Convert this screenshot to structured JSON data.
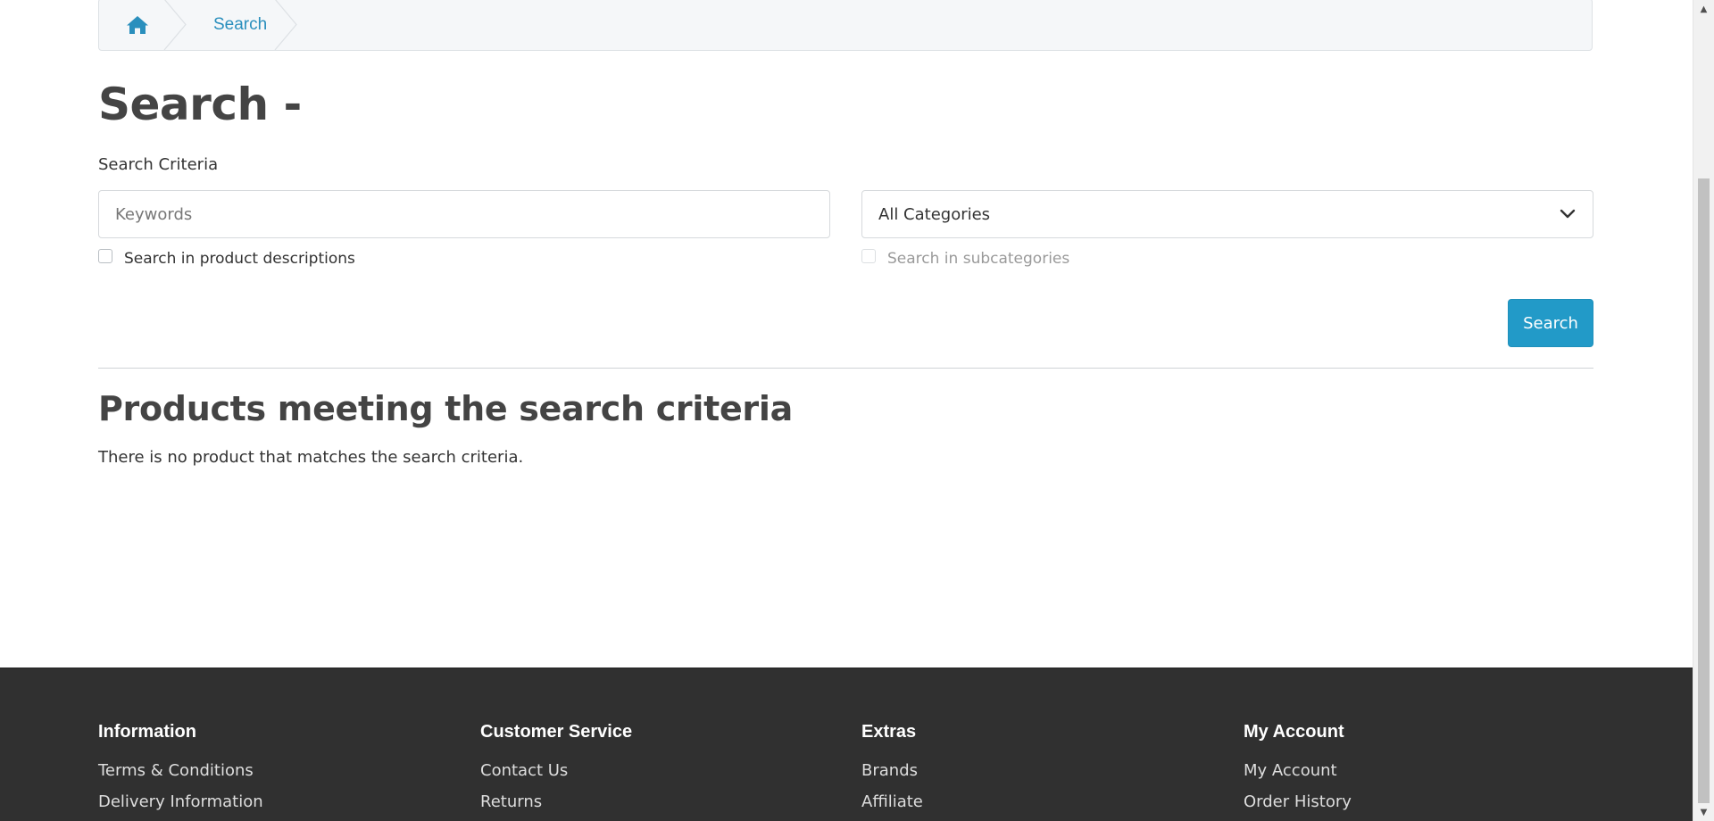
{
  "breadcrumb": {
    "home_icon": "home-icon",
    "current": "Search"
  },
  "page": {
    "title": "Search -",
    "criteria_label": "Search Criteria"
  },
  "search_form": {
    "keywords_placeholder": "Keywords",
    "keywords_value": "",
    "category_selected": "All Categories",
    "check_descriptions_label": "Search in product descriptions",
    "check_descriptions_checked": false,
    "check_subcategories_label": "Search in subcategories",
    "check_subcategories_checked": false,
    "check_subcategories_disabled": true,
    "submit_label": "Search"
  },
  "results": {
    "title": "Products meeting the search criteria",
    "empty_message": "There is no product that matches the search criteria."
  },
  "footer": {
    "columns": [
      {
        "heading": "Information",
        "links": [
          "Terms & Conditions",
          "Delivery Information"
        ]
      },
      {
        "heading": "Customer Service",
        "links": [
          "Contact Us",
          "Returns"
        ]
      },
      {
        "heading": "Extras",
        "links": [
          "Brands",
          "Affiliate"
        ]
      },
      {
        "heading": "My Account",
        "links": [
          "My Account",
          "Order History"
        ]
      }
    ]
  },
  "colors": {
    "accent": "#229ac8",
    "link": "#2a8fbd",
    "footer_bg": "#303030",
    "heading": "#444444"
  }
}
